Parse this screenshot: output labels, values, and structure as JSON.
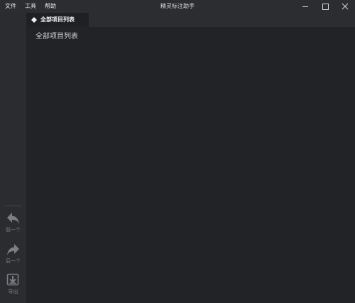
{
  "menubar": {
    "items": [
      {
        "label": "文件"
      },
      {
        "label": "工具"
      },
      {
        "label": "帮助"
      }
    ]
  },
  "window": {
    "title": "精灵标注助手"
  },
  "tabs": [
    {
      "label": "全部项目列表",
      "icon": "diamond-icon"
    }
  ],
  "main": {
    "heading": "全部项目列表"
  },
  "sidebar": {
    "actions": [
      {
        "label": "前一个",
        "icon": "previous-arrow-icon"
      },
      {
        "label": "后一个",
        "icon": "next-arrow-icon"
      },
      {
        "label": "导出",
        "icon": "export-download-icon"
      }
    ]
  },
  "colors": {
    "background": "#222326",
    "chrome": "#2c2d31",
    "active_tab": "#1f2023",
    "muted_icon": "#7d7e83"
  }
}
